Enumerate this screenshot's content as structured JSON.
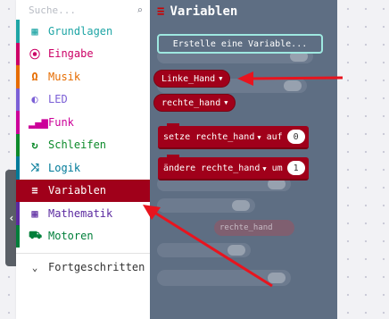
{
  "search": {
    "placeholder": "Suche..."
  },
  "categories": [
    {
      "label": "Grundlagen",
      "icon": "grid-icon",
      "glyph": "▦",
      "color": "#1ea5a5"
    },
    {
      "label": "Eingabe",
      "icon": "target-icon",
      "glyph": "⦿",
      "color": "#cc0066"
    },
    {
      "label": "Musik",
      "icon": "headphones-icon",
      "glyph": "Ω",
      "color": "#e66c00"
    },
    {
      "label": "LED",
      "icon": "toggle-icon",
      "glyph": "◐",
      "color": "#7b5fd6"
    },
    {
      "label": "Funk",
      "icon": "signal-bars-icon",
      "glyph": "▂▄▆",
      "color": "#cc0099"
    },
    {
      "label": "Schleifen",
      "icon": "loop-icon",
      "glyph": "↻",
      "color": "#0c8a2a"
    },
    {
      "label": "Logik",
      "icon": "shuffle-icon",
      "glyph": "⤨",
      "color": "#007a99"
    },
    {
      "label": "Variablen",
      "icon": "lines-icon",
      "glyph": "≡",
      "color": "#ffffff",
      "selected": true,
      "bg": "#a0001a"
    },
    {
      "label": "Mathematik",
      "icon": "calculator-icon",
      "glyph": "▦",
      "color": "#5b2aa0"
    },
    {
      "label": "Motoren",
      "icon": "car-icon",
      "glyph": "⛟",
      "color": "#007f3a"
    }
  ],
  "advanced": {
    "label": "Fortgeschritten",
    "icon": "chevron-down-icon",
    "glyph": "⌄"
  },
  "flyout": {
    "title": "Variablen",
    "title_icon": "lines-icon",
    "create_button": "Erstelle eine Variable...",
    "variables": [
      "Linke_Hand",
      "rechte_hand"
    ],
    "set_block": {
      "keyword": "setze",
      "var": "rechte_hand",
      "to": "auf",
      "value": "0"
    },
    "change_block": {
      "keyword": "ändere",
      "var": "rechte_hand",
      "by": "um",
      "value": "1"
    },
    "ghost_label": "rechte_hand"
  },
  "colors": {
    "variables": "#a0001a",
    "flyout_bg": "#5e6e83",
    "arrow": "#e8141e",
    "create_border": "#9ee8e0"
  }
}
